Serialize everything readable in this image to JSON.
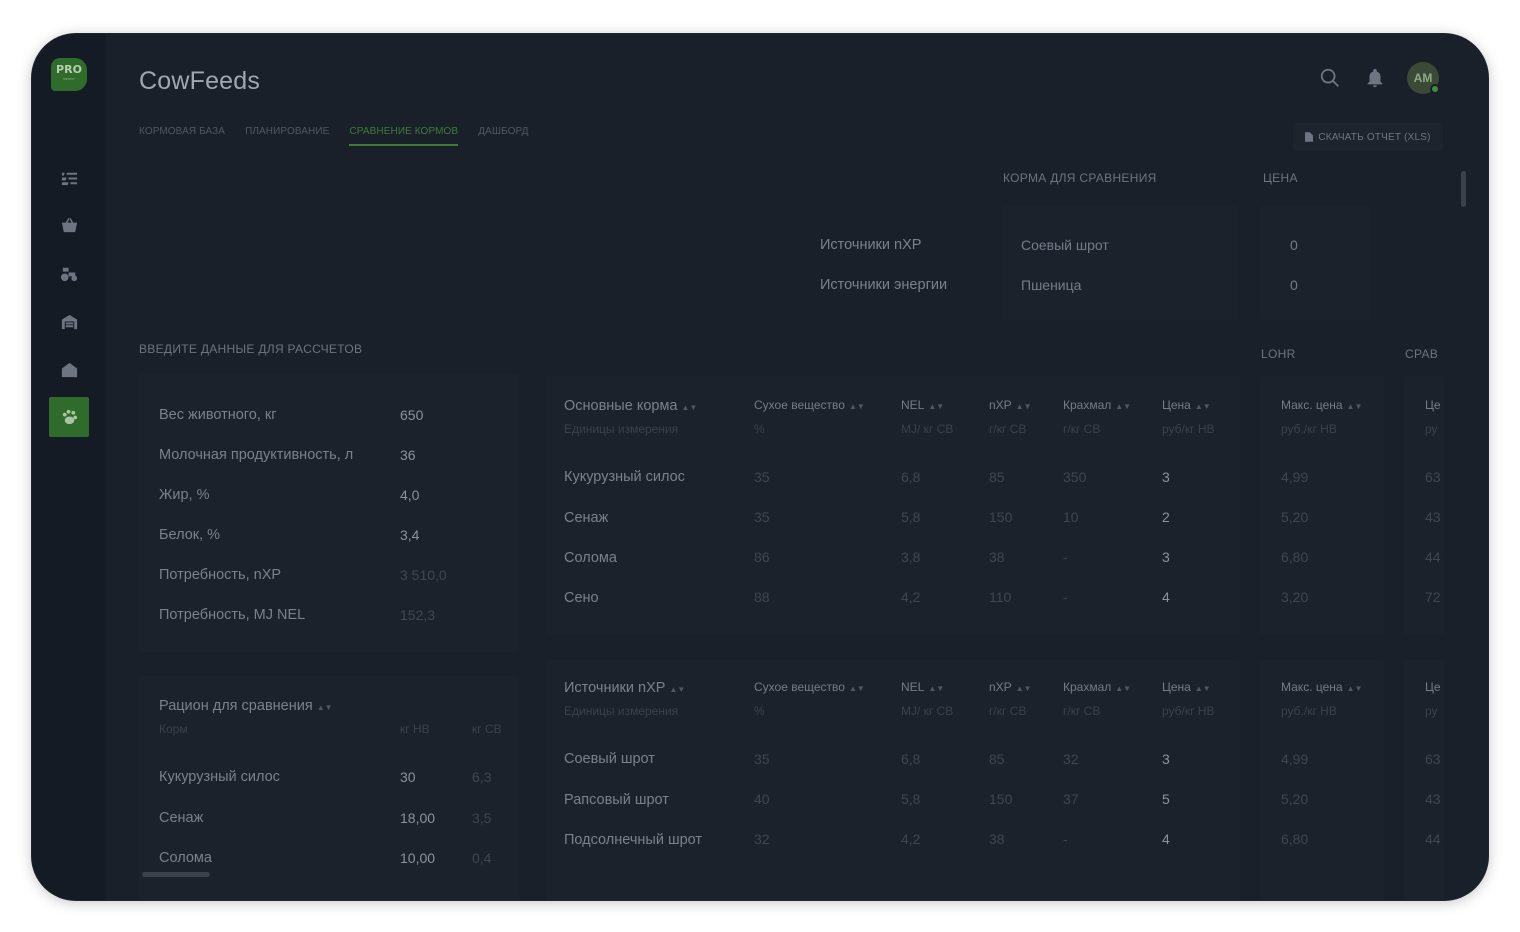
{
  "app": {
    "title": "CowFeeds",
    "logo_text": "PRO",
    "logo_sub": "farmer"
  },
  "tabs": [
    {
      "label": "КОРМОВАЯ БАЗА"
    },
    {
      "label": "ПЛАНИРОВАНИЕ"
    },
    {
      "label": "СРАВНЕНИЕ КОРМОВ"
    },
    {
      "label": "ДАШБОРД"
    }
  ],
  "header": {
    "avatar_initials": "AM",
    "download_label": "СКАЧАТЬ ОТЧЕТ (XLS)"
  },
  "compare": {
    "feeds_header": "КОРМА ДЛЯ СРАВНЕНИЯ",
    "price_header": "ЦЕНА",
    "rows": [
      {
        "label": "Источники  nXP",
        "feed": "Соевый шрот",
        "price": "0"
      },
      {
        "label": "Источники энергии",
        "feed": "Пшеница",
        "price": "0"
      }
    ]
  },
  "inputs": {
    "section_label": "ВВЕДИТЕ ДАННЫЕ ДЛЯ РАССЧЕТОВ",
    "rows": [
      {
        "label": "Вес животного, кг",
        "value": "650"
      },
      {
        "label": "Молочная продуктивность, л",
        "value": "36"
      },
      {
        "label": "Жир, %",
        "value": "4,0"
      },
      {
        "label": "Белок, %",
        "value": "3,4"
      },
      {
        "label": "Потребность, nXP",
        "value": "3 510,0"
      },
      {
        "label": "Потребность, MJ NEL",
        "value": "152,3"
      }
    ]
  },
  "ration": {
    "title": "Рацион для сравнения",
    "col_feed": "Корм",
    "col_nv": "кг НВ",
    "col_sv": "кг СВ",
    "rows": [
      {
        "feed": "Кукурузный силос",
        "nv": "30",
        "sv": "6,3"
      },
      {
        "feed": "Сенаж",
        "nv": "18,00",
        "sv": "3,5"
      },
      {
        "feed": "Солома",
        "nv": "10,00",
        "sv": "0,4"
      }
    ]
  },
  "side_headers": {
    "lohr": "LOHR",
    "sprav": "СРАВ"
  },
  "main_table": {
    "title": "Основные корма",
    "units_label": "Единицы измерения",
    "columns": [
      {
        "name": "Сухое вещество",
        "unit": "%"
      },
      {
        "name": "NEL",
        "unit": "MJ/ кг СВ"
      },
      {
        "name": "nXP",
        "unit": "г/кг СВ"
      },
      {
        "name": "Крахмал",
        "unit": "г/кг СВ"
      },
      {
        "name": "Цена",
        "unit": "руб/кг НВ"
      }
    ],
    "lohr_col": {
      "name": "Макс. цена",
      "unit": "руб./кг НВ"
    },
    "sprav_col": {
      "name": "Це",
      "unit": "ру"
    },
    "rows": [
      {
        "name": "Кукурузный силос",
        "sv": "35",
        "nel": "6,8",
        "nxp": "85",
        "starch": "350",
        "price": "3",
        "max": "4,99",
        "cmp": "63"
      },
      {
        "name": "Сенаж",
        "sv": "35",
        "nel": "5,8",
        "nxp": "150",
        "starch": "10",
        "price": "2",
        "max": "5,20",
        "cmp": "43"
      },
      {
        "name": "Солома",
        "sv": "86",
        "nel": "3,8",
        "nxp": "38",
        "starch": "-",
        "price": "3",
        "max": "6,80",
        "cmp": "44"
      },
      {
        "name": "Сено",
        "sv": "88",
        "nel": "4,2",
        "nxp": "110",
        "starch": "-",
        "price": "4",
        "max": "3,20",
        "cmp": "72"
      }
    ]
  },
  "nxp_table": {
    "title": "Источники nXP",
    "units_label": "Единицы измерения",
    "columns": [
      {
        "name": "Сухое вещество",
        "unit": "%"
      },
      {
        "name": "NEL",
        "unit": "MJ/ кг СВ"
      },
      {
        "name": "nXP",
        "unit": "г/кг СВ"
      },
      {
        "name": "Крахмал",
        "unit": "г/кг СВ"
      },
      {
        "name": "Цена",
        "unit": "руб/кг НВ"
      }
    ],
    "lohr_col": {
      "name": "Макс. цена",
      "unit": "руб./кг НВ"
    },
    "sprav_col": {
      "name": "Це",
      "unit": "ру"
    },
    "rows": [
      {
        "name": "Соевый шрот",
        "sv": "35",
        "nel": "6,8",
        "nxp": "85",
        "starch": "32",
        "price": "3",
        "max": "4,99",
        "cmp": "63"
      },
      {
        "name": "Рапсовый шрот",
        "sv": "40",
        "nel": "5,8",
        "nxp": "150",
        "starch": "37",
        "price": "5",
        "max": "5,20",
        "cmp": "43"
      },
      {
        "name": "Подсолнечный шрот",
        "sv": "32",
        "nel": "4,2",
        "nxp": "38",
        "starch": "-",
        "price": "4",
        "max": "6,80",
        "cmp": "44"
      }
    ]
  }
}
